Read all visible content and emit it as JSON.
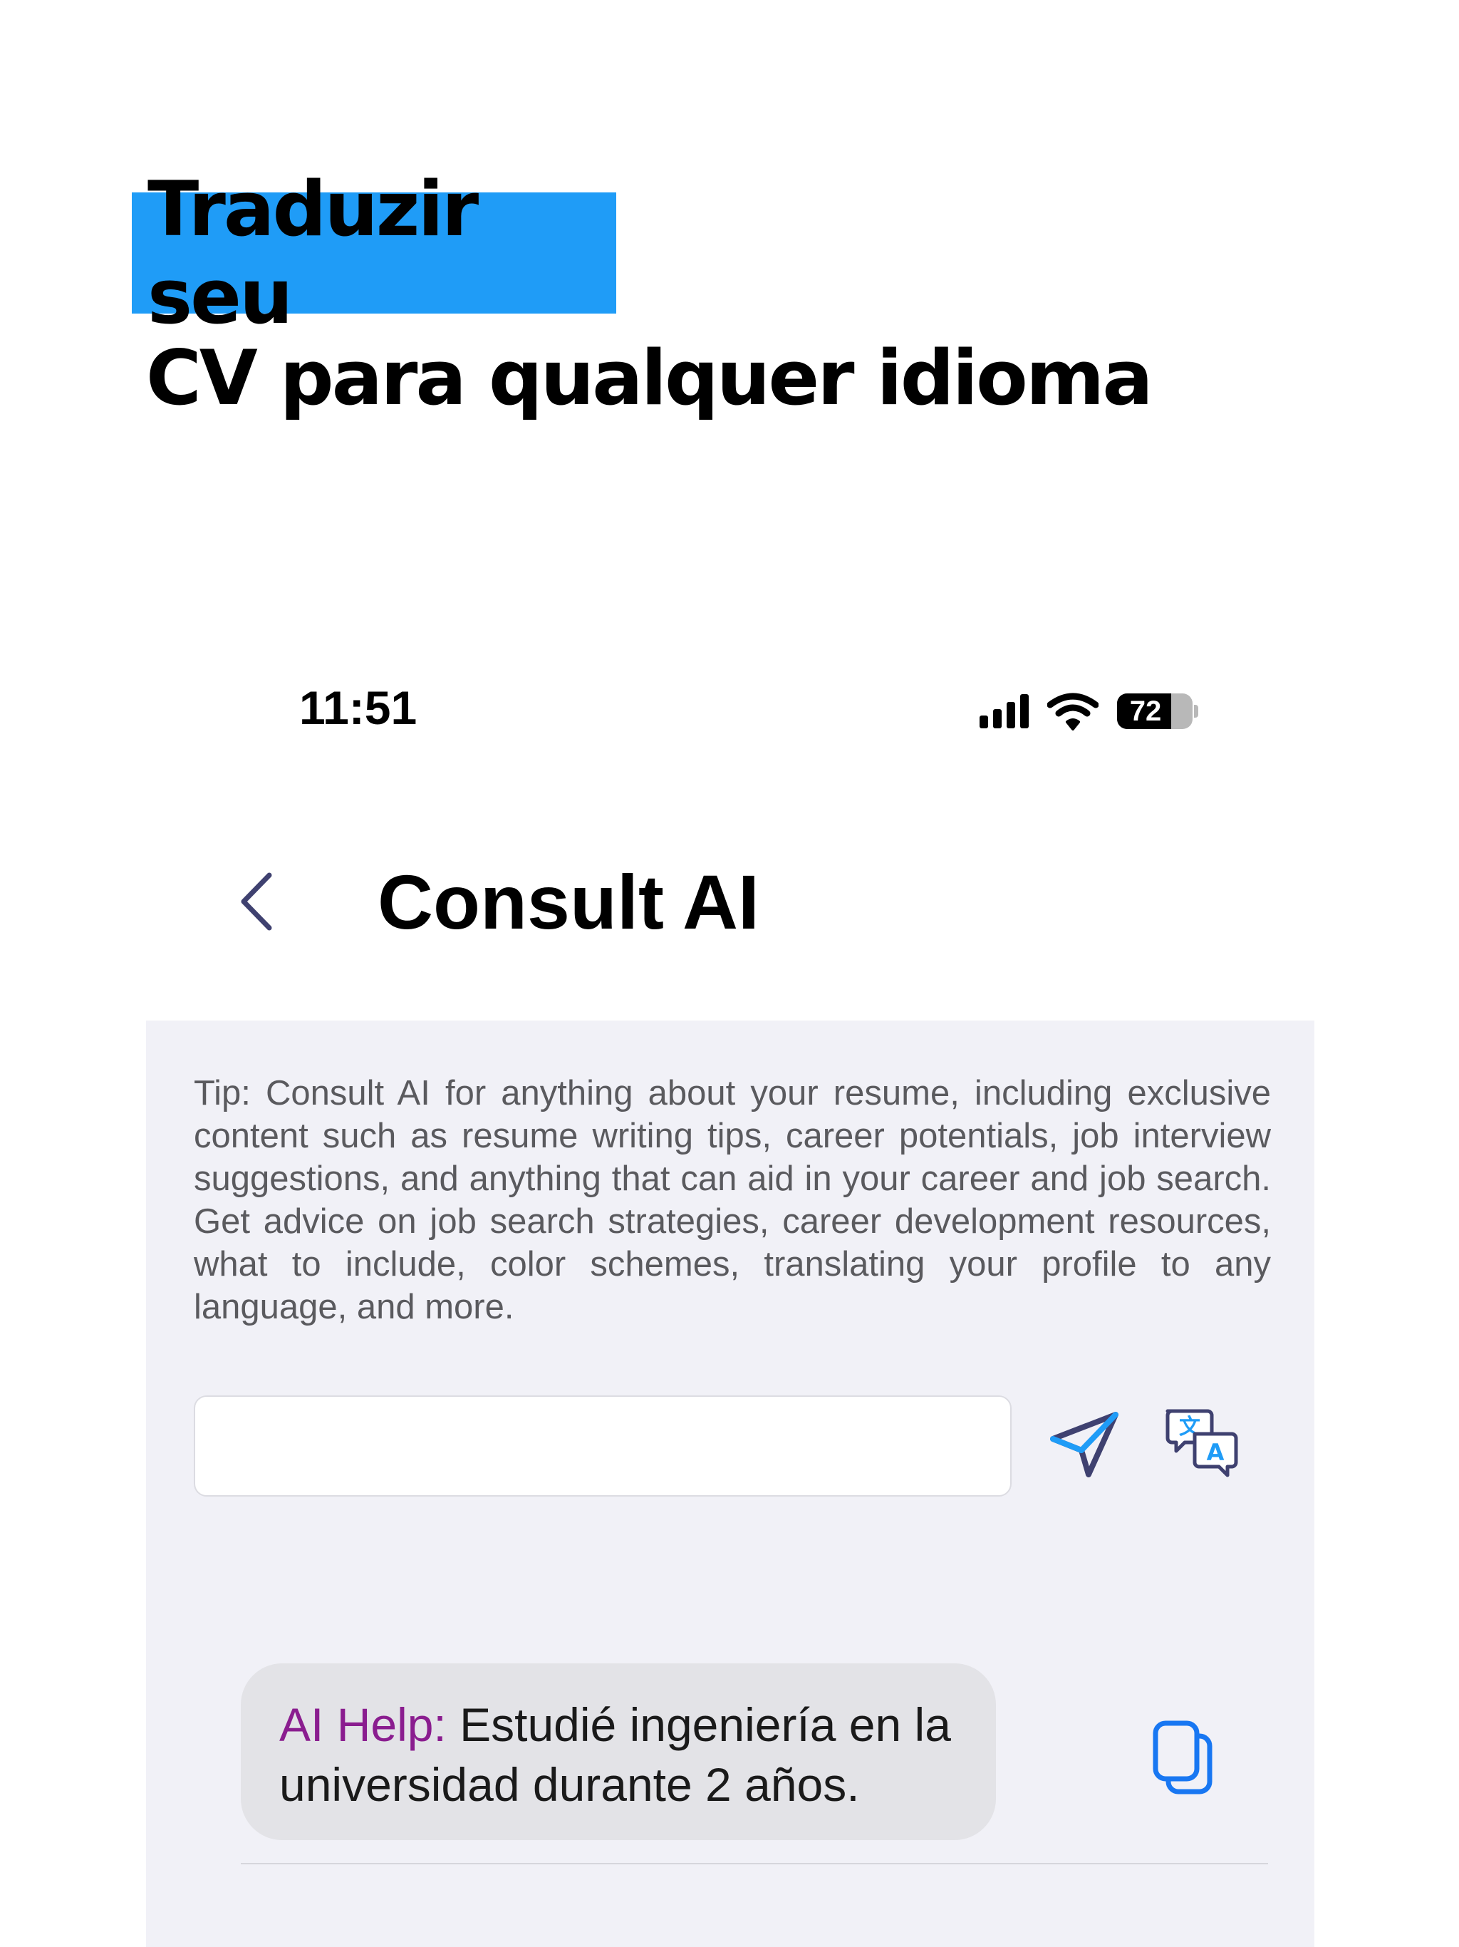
{
  "headline": {
    "line1": "Traduzir seu",
    "line2": "CV para qualquer idioma",
    "highlight_color": "#1f9cf7"
  },
  "status_bar": {
    "time": "11:51",
    "battery_level": "72",
    "icons": [
      "signal-icon",
      "wifi-icon",
      "battery-icon"
    ]
  },
  "nav": {
    "back_icon": "chevron-left-icon",
    "title": "Consult AI"
  },
  "tip": {
    "text": "Tip: Consult AI for anything about your resume, including exclusive content such as resume writing tips, career potentials, job interview suggestions, and anything that can aid in your career and job search. Get advice on job search strategies, career development resources, what to include, color schemes, translating your profile to any language, and more."
  },
  "input": {
    "value": "",
    "placeholder": ""
  },
  "actions": {
    "send_icon": "paper-plane-icon",
    "translate_icon": "translate-icon"
  },
  "message": {
    "label": "AI Help:",
    "text": " Estudié ingeniería en la universidad durante 2 años.",
    "label_color": "#8a1d8f",
    "copy_icon": "copy-icon"
  },
  "colors": {
    "accent": "#1f9cf7",
    "panel_bg": "#f1f1f7",
    "bubble_bg": "#e3e3e7",
    "icon_dark": "#3f4170"
  }
}
